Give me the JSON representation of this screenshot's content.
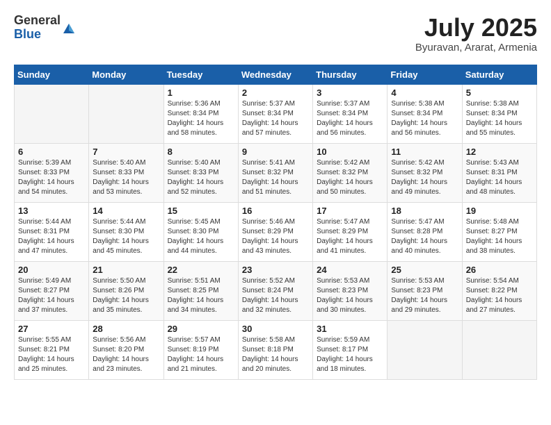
{
  "header": {
    "logo_general": "General",
    "logo_blue": "Blue",
    "month_year": "July 2025",
    "location": "Byuravan, Ararat, Armenia"
  },
  "weekdays": [
    "Sunday",
    "Monday",
    "Tuesday",
    "Wednesday",
    "Thursday",
    "Friday",
    "Saturday"
  ],
  "weeks": [
    [
      {
        "day": "",
        "info": ""
      },
      {
        "day": "",
        "info": ""
      },
      {
        "day": "1",
        "sunrise": "5:36 AM",
        "sunset": "8:34 PM",
        "daylight": "14 hours and 58 minutes."
      },
      {
        "day": "2",
        "sunrise": "5:37 AM",
        "sunset": "8:34 PM",
        "daylight": "14 hours and 57 minutes."
      },
      {
        "day": "3",
        "sunrise": "5:37 AM",
        "sunset": "8:34 PM",
        "daylight": "14 hours and 56 minutes."
      },
      {
        "day": "4",
        "sunrise": "5:38 AM",
        "sunset": "8:34 PM",
        "daylight": "14 hours and 56 minutes."
      },
      {
        "day": "5",
        "sunrise": "5:38 AM",
        "sunset": "8:34 PM",
        "daylight": "14 hours and 55 minutes."
      }
    ],
    [
      {
        "day": "6",
        "sunrise": "5:39 AM",
        "sunset": "8:33 PM",
        "daylight": "14 hours and 54 minutes."
      },
      {
        "day": "7",
        "sunrise": "5:40 AM",
        "sunset": "8:33 PM",
        "daylight": "14 hours and 53 minutes."
      },
      {
        "day": "8",
        "sunrise": "5:40 AM",
        "sunset": "8:33 PM",
        "daylight": "14 hours and 52 minutes."
      },
      {
        "day": "9",
        "sunrise": "5:41 AM",
        "sunset": "8:32 PM",
        "daylight": "14 hours and 51 minutes."
      },
      {
        "day": "10",
        "sunrise": "5:42 AM",
        "sunset": "8:32 PM",
        "daylight": "14 hours and 50 minutes."
      },
      {
        "day": "11",
        "sunrise": "5:42 AM",
        "sunset": "8:32 PM",
        "daylight": "14 hours and 49 minutes."
      },
      {
        "day": "12",
        "sunrise": "5:43 AM",
        "sunset": "8:31 PM",
        "daylight": "14 hours and 48 minutes."
      }
    ],
    [
      {
        "day": "13",
        "sunrise": "5:44 AM",
        "sunset": "8:31 PM",
        "daylight": "14 hours and 47 minutes."
      },
      {
        "day": "14",
        "sunrise": "5:44 AM",
        "sunset": "8:30 PM",
        "daylight": "14 hours and 45 minutes."
      },
      {
        "day": "15",
        "sunrise": "5:45 AM",
        "sunset": "8:30 PM",
        "daylight": "14 hours and 44 minutes."
      },
      {
        "day": "16",
        "sunrise": "5:46 AM",
        "sunset": "8:29 PM",
        "daylight": "14 hours and 43 minutes."
      },
      {
        "day": "17",
        "sunrise": "5:47 AM",
        "sunset": "8:29 PM",
        "daylight": "14 hours and 41 minutes."
      },
      {
        "day": "18",
        "sunrise": "5:47 AM",
        "sunset": "8:28 PM",
        "daylight": "14 hours and 40 minutes."
      },
      {
        "day": "19",
        "sunrise": "5:48 AM",
        "sunset": "8:27 PM",
        "daylight": "14 hours and 38 minutes."
      }
    ],
    [
      {
        "day": "20",
        "sunrise": "5:49 AM",
        "sunset": "8:27 PM",
        "daylight": "14 hours and 37 minutes."
      },
      {
        "day": "21",
        "sunrise": "5:50 AM",
        "sunset": "8:26 PM",
        "daylight": "14 hours and 35 minutes."
      },
      {
        "day": "22",
        "sunrise": "5:51 AM",
        "sunset": "8:25 PM",
        "daylight": "14 hours and 34 minutes."
      },
      {
        "day": "23",
        "sunrise": "5:52 AM",
        "sunset": "8:24 PM",
        "daylight": "14 hours and 32 minutes."
      },
      {
        "day": "24",
        "sunrise": "5:53 AM",
        "sunset": "8:23 PM",
        "daylight": "14 hours and 30 minutes."
      },
      {
        "day": "25",
        "sunrise": "5:53 AM",
        "sunset": "8:23 PM",
        "daylight": "14 hours and 29 minutes."
      },
      {
        "day": "26",
        "sunrise": "5:54 AM",
        "sunset": "8:22 PM",
        "daylight": "14 hours and 27 minutes."
      }
    ],
    [
      {
        "day": "27",
        "sunrise": "5:55 AM",
        "sunset": "8:21 PM",
        "daylight": "14 hours and 25 minutes."
      },
      {
        "day": "28",
        "sunrise": "5:56 AM",
        "sunset": "8:20 PM",
        "daylight": "14 hours and 23 minutes."
      },
      {
        "day": "29",
        "sunrise": "5:57 AM",
        "sunset": "8:19 PM",
        "daylight": "14 hours and 21 minutes."
      },
      {
        "day": "30",
        "sunrise": "5:58 AM",
        "sunset": "8:18 PM",
        "daylight": "14 hours and 20 minutes."
      },
      {
        "day": "31",
        "sunrise": "5:59 AM",
        "sunset": "8:17 PM",
        "daylight": "14 hours and 18 minutes."
      },
      {
        "day": "",
        "info": ""
      },
      {
        "day": "",
        "info": ""
      }
    ]
  ]
}
